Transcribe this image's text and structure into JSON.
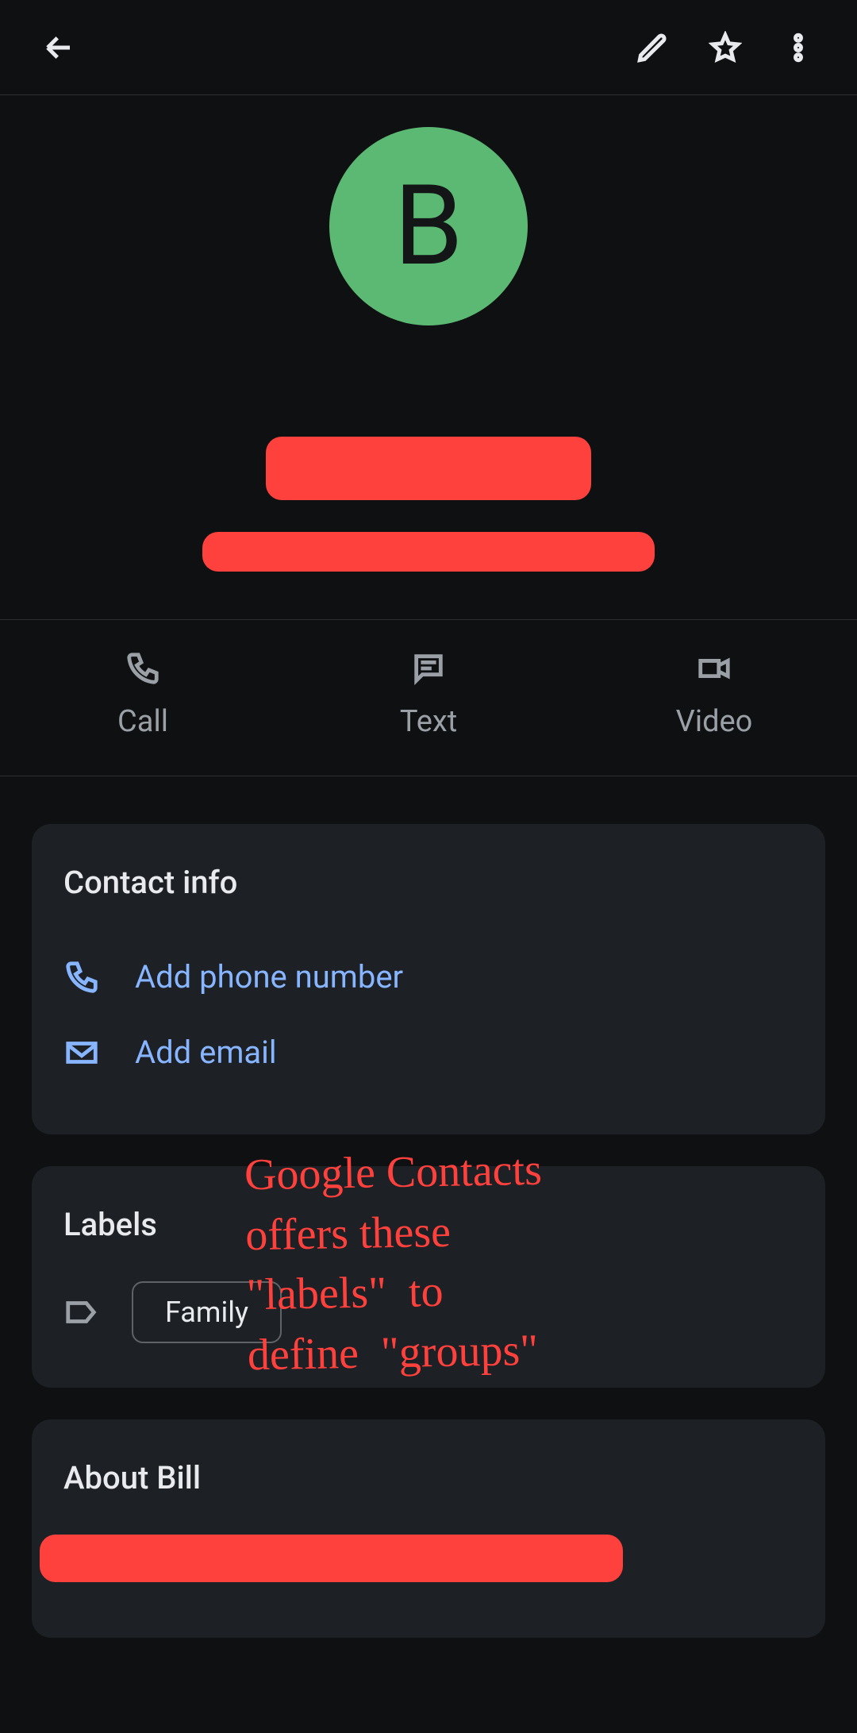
{
  "avatar": {
    "letter": "B",
    "bg": "#5bb974"
  },
  "actions": {
    "call": "Call",
    "text": "Text",
    "video": "Video"
  },
  "contact_info": {
    "title": "Contact info",
    "add_phone": "Add phone number",
    "add_email": "Add email"
  },
  "labels_section": {
    "title": "Labels",
    "chips": [
      "Family"
    ]
  },
  "about": {
    "title": "About Bill"
  },
  "annotation": "Google Contacts\noffers these\n\"labels\"  to\ndefine  \"groups\""
}
